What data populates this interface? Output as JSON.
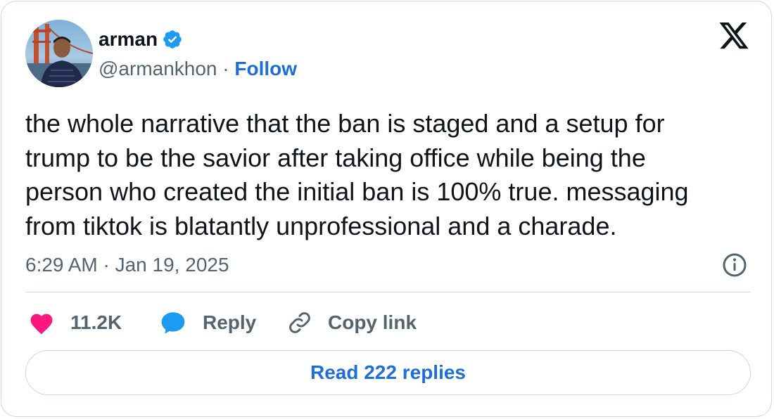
{
  "author": {
    "name": "arman",
    "verified": true,
    "handle": "@armankhon",
    "separator": "·",
    "follow_label": "Follow"
  },
  "tweet": {
    "text": "the whole narrative that the ban is staged and a setup for\ntrump to be the savior after taking office while being the\nperson who created the initial ban is 100% true. messaging\nfrom tiktok is blatantly unprofessional and a charade.",
    "timestamp": "6:29 AM · Jan 19, 2025"
  },
  "actions": {
    "like_count": "11.2K",
    "reply_label": "Reply",
    "copy_link_label": "Copy link"
  },
  "read_replies_label": "Read 222 replies",
  "icons": {
    "platform_logo": "x-logo",
    "verified": "verified-badge-icon",
    "info": "info-icon",
    "like": "heart-icon",
    "reply": "speech-bubble-icon",
    "copy_link": "link-icon"
  },
  "colors": {
    "accent_blue": "#1d6fd6",
    "verified_blue": "#1d9bf0",
    "like_pink": "#f91880",
    "secondary_text": "#536471",
    "primary_text": "#0f1419",
    "border": "#cfd9de"
  }
}
